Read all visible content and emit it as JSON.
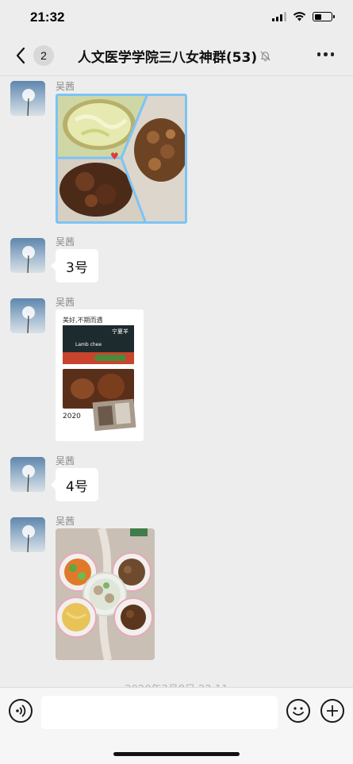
{
  "status_bar": {
    "time": "21:32",
    "battery_level": 0.4,
    "signal_bars": 3
  },
  "nav": {
    "back_badge": "2",
    "title": "人文医学学院三八女神群(53)",
    "muted": true
  },
  "messages": [
    {
      "sender": "吴茜",
      "type": "image",
      "image_description": "food-collage-three-dishes"
    },
    {
      "sender": "吴茜",
      "type": "text",
      "text": "3号"
    },
    {
      "sender": "吴茜",
      "type": "image",
      "image_description": "lamb-poster",
      "image_texts": {
        "line1": "美好,不期而遇",
        "line2": "Lamb chee",
        "line3": "宁夏羊",
        "year": "2020"
      }
    },
    {
      "sender": "吴茜",
      "type": "text",
      "text": "4号"
    },
    {
      "sender": "吴茜",
      "type": "image",
      "image_description": "table-of-five-dishes"
    }
  ],
  "timestamp": "2020年3月8日 22:11",
  "input": {
    "placeholder": ""
  },
  "colors": {
    "background": "#ededed",
    "bubble": "#ffffff",
    "selection_border": "#7cc4f5"
  }
}
